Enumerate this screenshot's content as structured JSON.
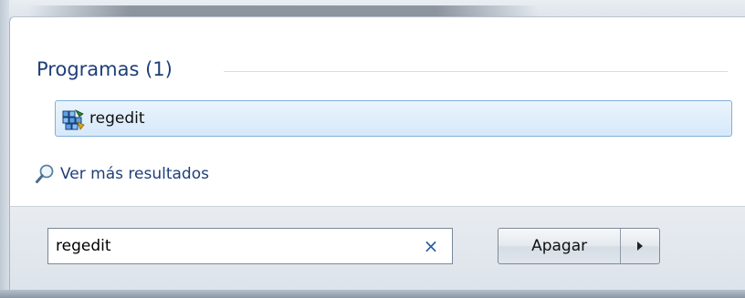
{
  "search_results": {
    "section_title": "Programas (1)",
    "items": [
      {
        "label": "regedit",
        "icon": "registry-editor-icon"
      }
    ],
    "more_results_label": "Ver más resultados"
  },
  "search": {
    "value": "regedit",
    "clear_label": "×"
  },
  "power": {
    "shutdown_label": "Apagar"
  },
  "colors": {
    "accent_text": "#1e3f78",
    "selection_border": "#7fb0dc",
    "selection_fill": "#d6e9fa"
  }
}
